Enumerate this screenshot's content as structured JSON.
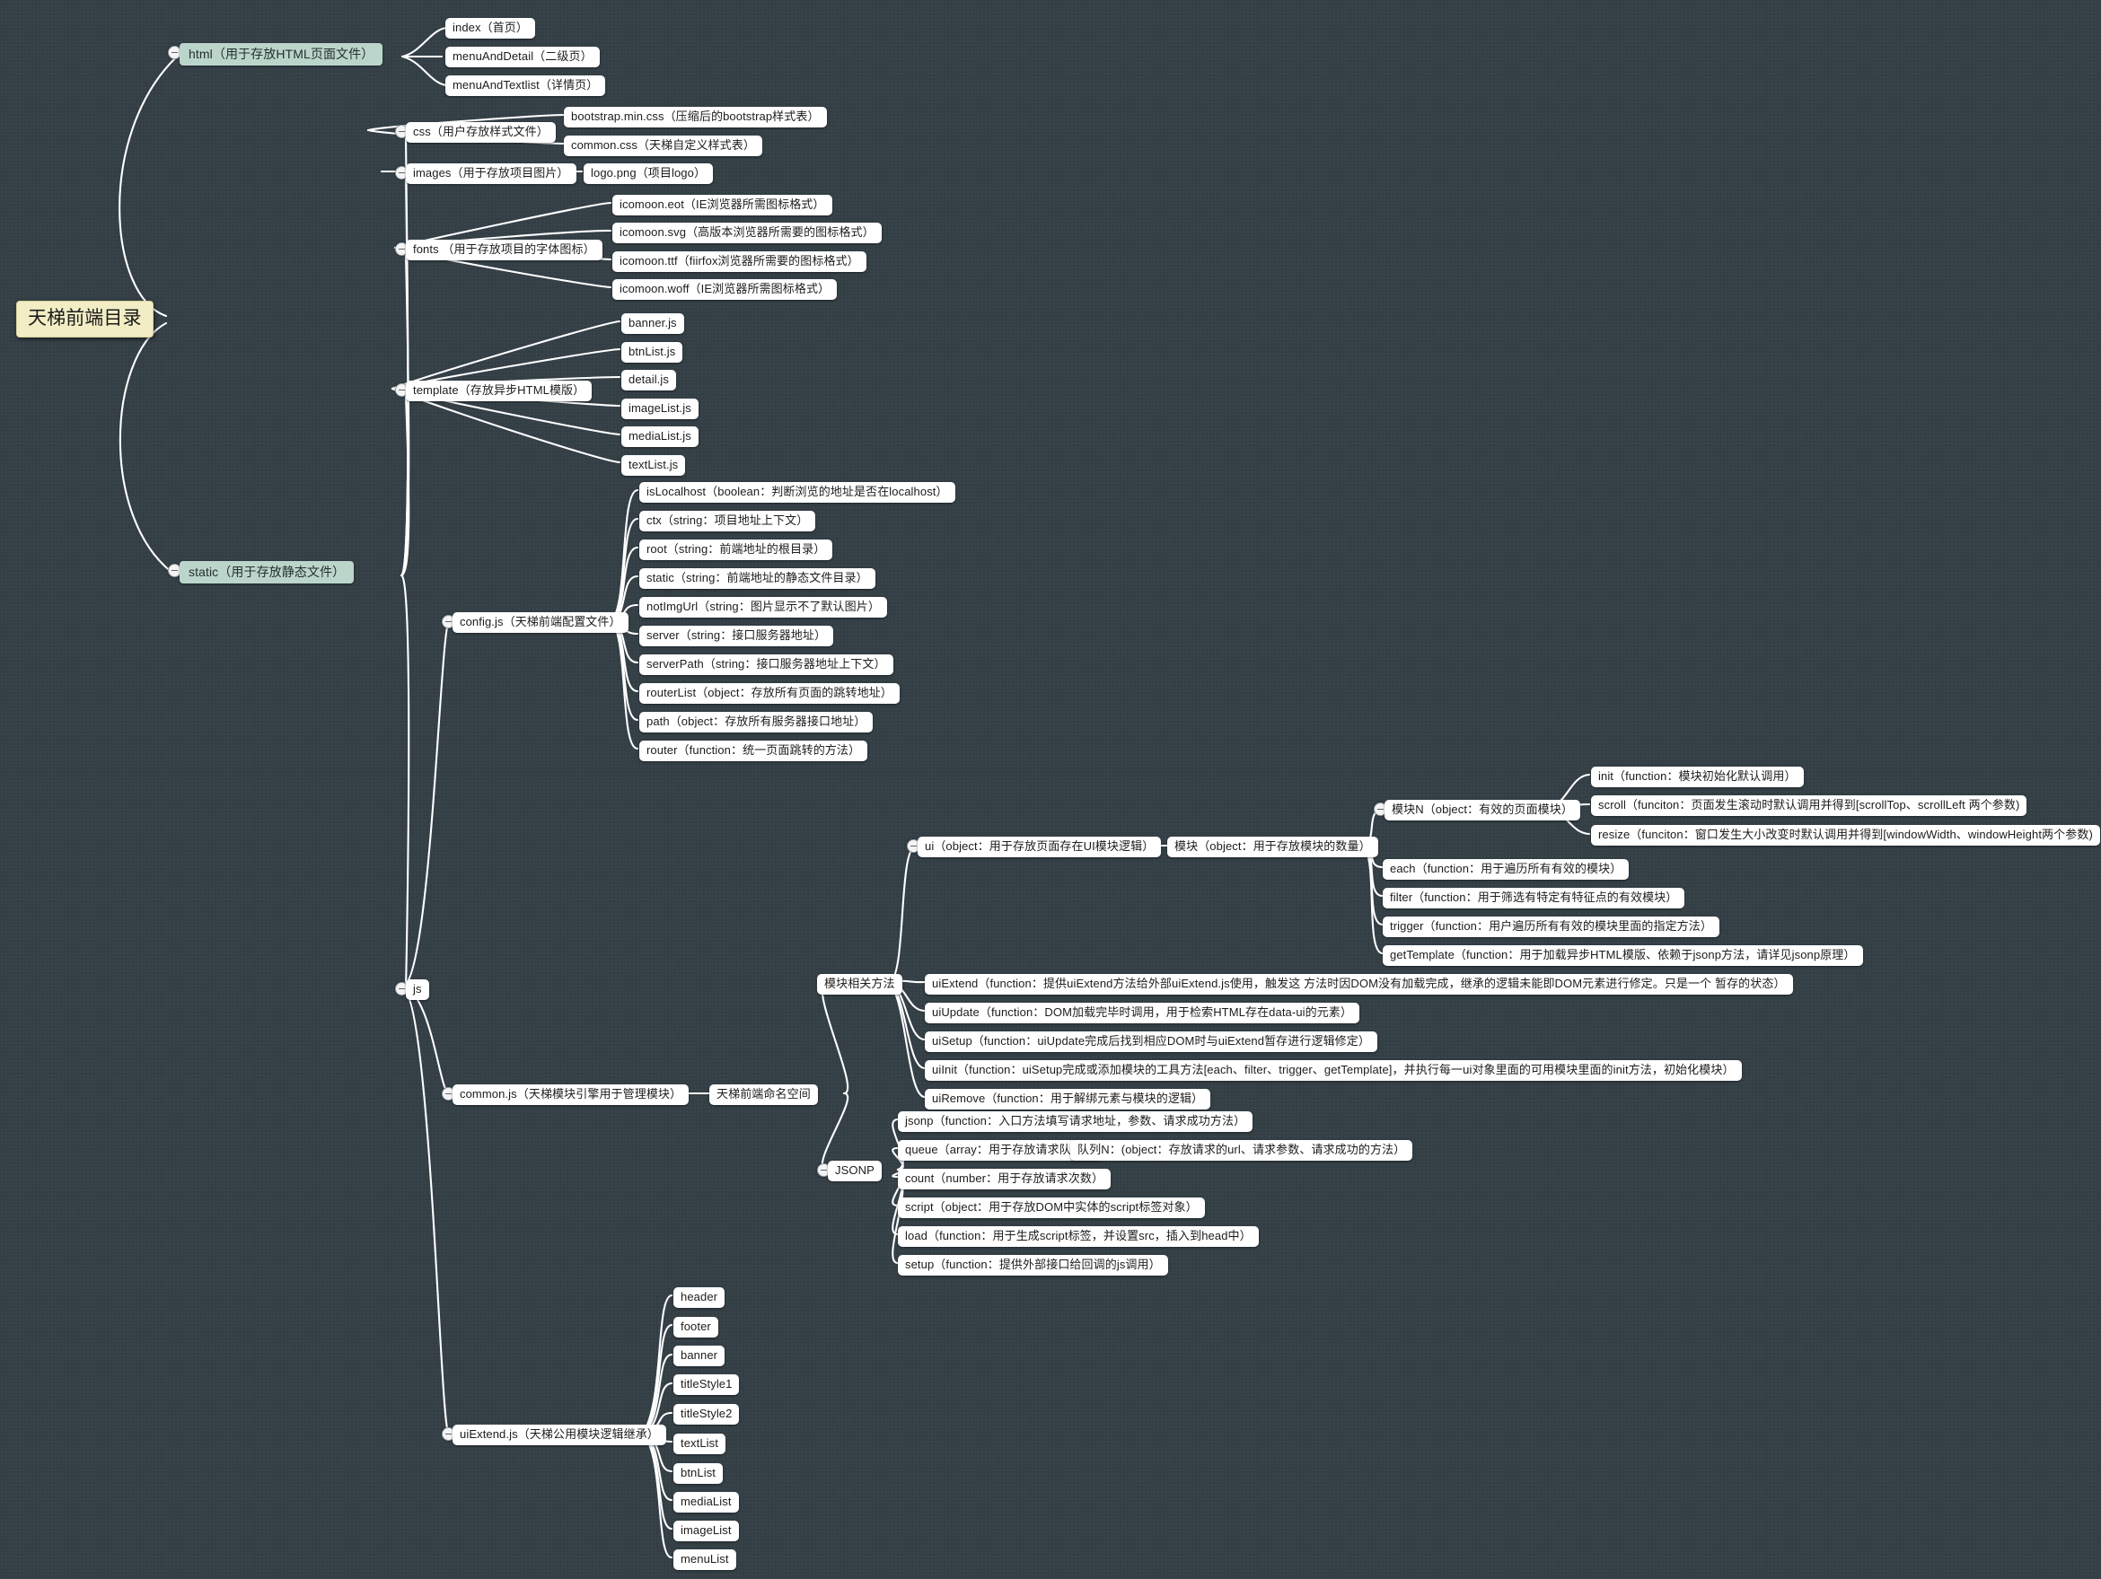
{
  "diagram": {
    "title": "天梯前端目录",
    "type": "mindmap",
    "background_color": "#333e45",
    "root_color": "#f2edc4",
    "level1_color": "#bcd5cb",
    "node_color": "#ffffff",
    "link_color": "#ffffff"
  },
  "nodes": {
    "root": "天梯前端目录",
    "html": "html（用于存放HTML页面文件）",
    "html_children": [
      "index（首页）",
      "menuAndDetail（二级页）",
      "menuAndTextlist（详情页）"
    ],
    "static": "static（用于存放静态文件）",
    "css": "css（用户存放样式文件）",
    "css_children": [
      "bootstrap.min.css（压缩后的bootstrap样式表）",
      "common.css（天梯自定义样式表）"
    ],
    "images": "images（用于存放项目图片）",
    "images_children": [
      "logo.png（项目logo）"
    ],
    "fonts": "fonts （用于存放项目的字体图标）",
    "fonts_children": [
      "icomoon.eot（IE浏览器所需图标格式）",
      "icomoon.svg（高版本浏览器所需要的图标格式）",
      "icomoon.ttf（fiirfox浏览器所需要的图标格式）",
      "icomoon.woff（IE浏览器所需图标格式）"
    ],
    "template": "template（存放异步HTML模版）",
    "template_children": [
      "banner.js",
      "btnList.js",
      "detail.js",
      "imageList.js",
      "mediaList.js",
      "textList.js"
    ],
    "js": "js",
    "config": "config.js（天梯前端配置文件）",
    "config_children": [
      "isLocalhost（boolean：判断浏览的地址是否在localhost）",
      "ctx（string：项目地址上下文）",
      "root（string：前端地址的根目录）",
      "static（string：前端地址的静态文件目录）",
      "notImgUrl（string：图片显示不了默认图片）",
      "server（string：接口服务器地址）",
      "serverPath（string：接口服务器地址上下文）",
      "routerList（object：存放所有页面的跳转地址）",
      "path（object：存放所有服务器接口地址）",
      "router（function：统一页面跳转的方法）"
    ],
    "common": "common.js（天梯模块引擎用于管理模块）",
    "namespace": "天梯前端命名空间",
    "module_methods": "模块相关方法",
    "ui": "ui（object：用于存放页面存在UI模块逻辑）",
    "module": "模块（object：用于存放模块的数量）",
    "moduleN": "模块N（object：有效的页面模块）",
    "moduleN_children": [
      "init（function：模块初始化默认调用）",
      "scroll（funciton：页面发生滚动时默认调用并得到[scrollTop、scrollLeft 两个参数)",
      "resize（funciton：窗口发生大小改变时默认调用并得到[windowWidth、windowHeight两个参数)"
    ],
    "module_children": [
      "each（function：用于遍历所有有效的模块）",
      "filter（function：用于筛选有特定有特征点的有效模块）",
      "trigger（function：用户遍历所有有效的模块里面的指定方法）",
      "getTemplate（function：用于加载异步HTML模版、依赖于jsonp方法，请详见jsonp原理）"
    ],
    "module_methods_children": [
      "uiExtend（function：提供uiExtend方法给外部uiExtend.js使用，触发这 方法时因DOM没有加载完成，继承的逻辑未能即DOM元素进行修定。只是一个 暂存的状态）",
      "uiUpdate（function：DOM加载完毕时调用，用于检索HTML存在data-ui的元素）",
      "uiSetup（function：uiUpdate完成后找到相应DOM时与uiExtend暂存进行逻辑修定）",
      "uiInit（function：uiSetup完成或添加模块的工具方法[each、filter、trigger、getTemplate]，并执行每一ui对象里面的可用模块里面的init方法，初始化模块）",
      "uiRemove（function：用于解绑元素与模块的逻辑）"
    ],
    "jsonp": "JSONP",
    "jsonp_children": [
      "jsonp（function：入口方法填写请求地址，参数、请求成功方法）",
      "queue（array：用于存放请求队列）",
      "count（number：用于存放请求次数）",
      "script（object：用于存放DOM中实体的script标签对象）",
      "load（function：用于生成script标签，并设置src，插入到head中）",
      "setup（function：提供外部接口给回调的js调用）"
    ],
    "queueN": "队列N：(object：存放请求的url、请求参数、请求成功的方法）",
    "uiExtend": "uiExtend.js（天梯公用模块逻辑继承）",
    "uiExtend_children": [
      "header",
      "footer",
      "banner",
      "titleStyle1",
      "titleStyle2",
      "textList",
      "btnList",
      "mediaList",
      "imageList",
      "menuList"
    ]
  }
}
